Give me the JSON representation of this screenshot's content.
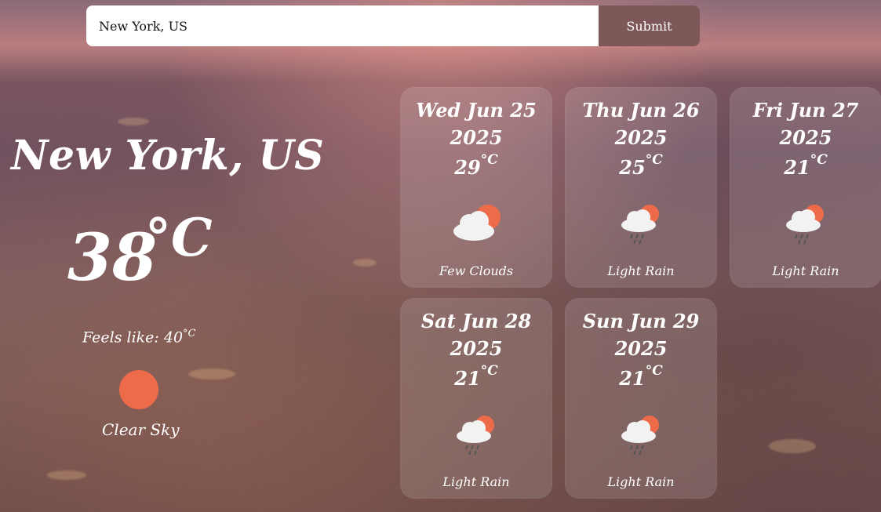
{
  "search": {
    "value": "New York, US",
    "button_label": "Submit"
  },
  "current": {
    "city": "New York, US",
    "temperature": "38",
    "unit": "°C",
    "feels_like_label": "Feels like: 40",
    "feels_like_unit": "°C",
    "description": "Clear Sky",
    "icon": "sun-icon"
  },
  "forecast": [
    {
      "weekday_date": "Wed Jun 25",
      "year": "2025",
      "temp": "29",
      "unit": "°C",
      "description": "Few Clouds",
      "icon": "cloud-sun-icon"
    },
    {
      "weekday_date": "Thu Jun 26",
      "year": "2025",
      "temp": "25",
      "unit": "°C",
      "description": "Light Rain",
      "icon": "rain-cloud-sun-icon"
    },
    {
      "weekday_date": "Fri Jun 27",
      "year": "2025",
      "temp": "21",
      "unit": "°C",
      "description": "Light Rain",
      "icon": "rain-cloud-sun-icon"
    },
    {
      "weekday_date": "Sat Jun 28",
      "year": "2025",
      "temp": "21",
      "unit": "°C",
      "description": "Light Rain",
      "icon": "rain-cloud-sun-icon"
    },
    {
      "weekday_date": "Sun Jun 29",
      "year": "2025",
      "temp": "21",
      "unit": "°C",
      "description": "Light Rain",
      "icon": "rain-cloud-sun-icon"
    }
  ],
  "colors": {
    "accent": "#7e5758",
    "sun": "#ee6b4a",
    "cloud": "#f2f2f2"
  }
}
